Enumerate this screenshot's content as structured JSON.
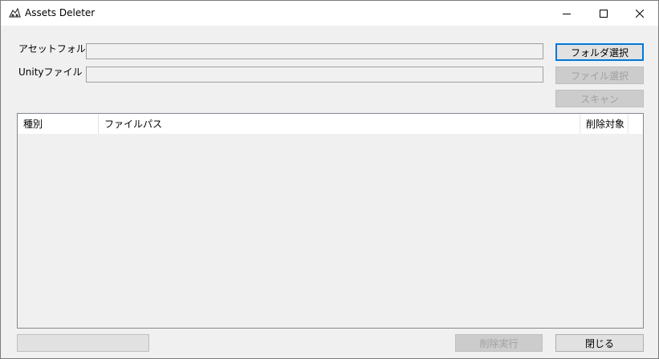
{
  "window": {
    "title": "Assets Deleter",
    "icon": "unity-cloud-icon"
  },
  "fields": {
    "asset_folder_label": "アセットフォルダ",
    "asset_folder_value": "",
    "unity_file_label": "Unityファイル",
    "unity_file_value": ""
  },
  "buttons": {
    "select_folder": "フォルダ選択",
    "select_file": "ファイル選択",
    "scan": "スキャン",
    "execute_delete": "削除実行",
    "close": "閉じる"
  },
  "list": {
    "columns": [
      "種別",
      "ファイルパス",
      "削除対象"
    ],
    "rows": []
  },
  "status": ""
}
